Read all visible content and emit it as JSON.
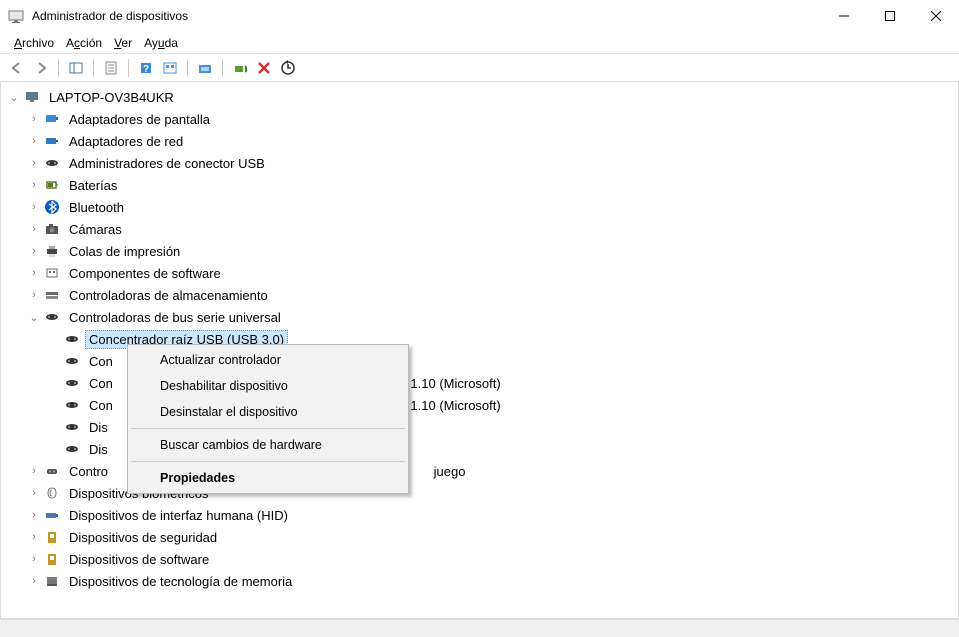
{
  "window": {
    "title": "Administrador de dispositivos"
  },
  "menu": {
    "file": "Archivo",
    "action": "Acción",
    "view": "Ver",
    "help": "Ayuda"
  },
  "tree": {
    "root": "LAPTOP-OV3B4UKR",
    "cat_display": "Adaptadores de pantalla",
    "cat_network": "Adaptadores de red",
    "cat_usb_conn": "Administradores de conector USB",
    "cat_batteries": "Baterías",
    "cat_bluetooth": "Bluetooth",
    "cat_cameras": "Cámaras",
    "cat_print": "Colas de impresión",
    "cat_softcomp": "Componentes de software",
    "cat_storage": "Controladoras de almacenamiento",
    "cat_usb_bus": "Controladoras de bus serie universal",
    "usb_root": "Concentrador raíz USB (USB 3.0)",
    "usb_con1": "Con",
    "usb_con2_prefix": "Con",
    "usb_con2_suffix": " - 1.10 (Microsoft)",
    "usb_con3_prefix": "Con",
    "usb_con3_suffix": " - 1.10 (Microsoft)",
    "usb_dis1": "Dis",
    "usb_dis2": "Dis",
    "cat_game_prefix": "Contro",
    "cat_game_suffix": " juego",
    "cat_biometric": "Dispositivos biométricos",
    "cat_hid": "Dispositivos de interfaz humana (HID)",
    "cat_security": "Dispositivos de seguridad",
    "cat_swdev": "Dispositivos de software",
    "cat_memtech": "Dispositivos de tecnología de memoria"
  },
  "context_menu": {
    "update_driver": "Actualizar controlador",
    "disable": "Deshabilitar dispositivo",
    "uninstall": "Desinstalar el dispositivo",
    "scan_hw": "Buscar cambios de hardware",
    "properties": "Propiedades"
  }
}
